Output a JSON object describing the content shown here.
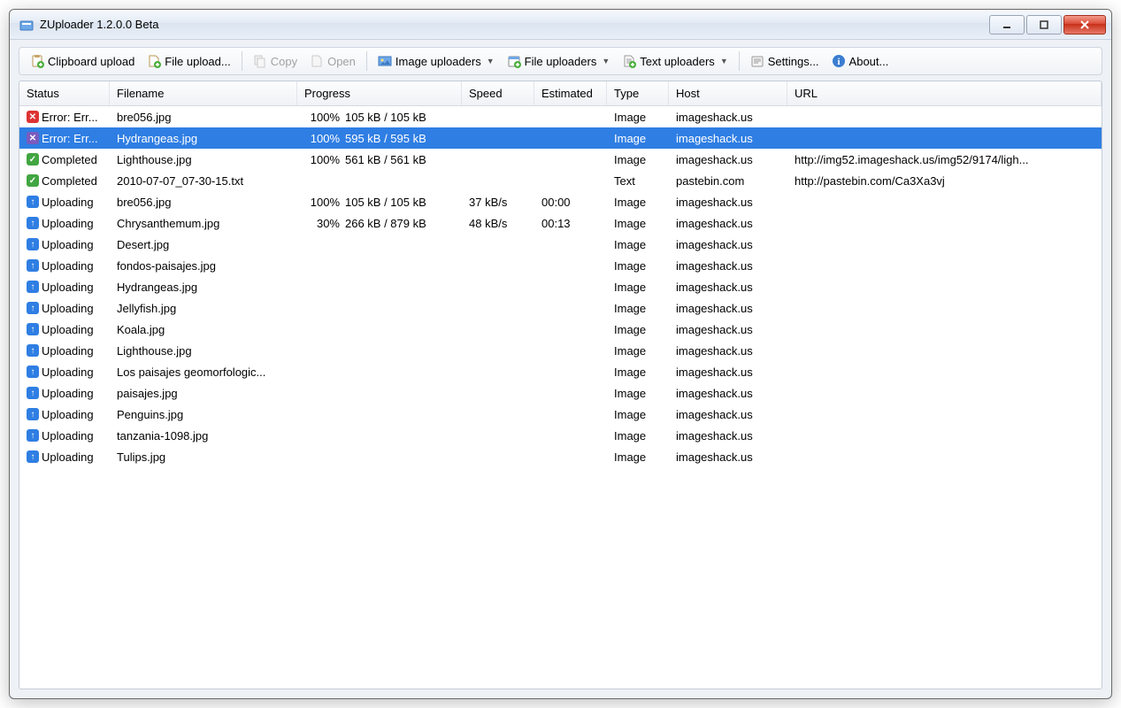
{
  "window": {
    "title": "ZUploader 1.2.0.0 Beta"
  },
  "toolbar": {
    "clipboard_upload": "Clipboard upload",
    "file_upload": "File upload...",
    "copy": "Copy",
    "open": "Open",
    "image_uploaders": "Image uploaders",
    "file_uploaders": "File uploaders",
    "text_uploaders": "Text uploaders",
    "settings": "Settings...",
    "about": "About..."
  },
  "columns": {
    "status": "Status",
    "filename": "Filename",
    "progress": "Progress",
    "speed": "Speed",
    "estimated": "Estimated",
    "type": "Type",
    "host": "Host",
    "url": "URL"
  },
  "rows": [
    {
      "status_icon": "error",
      "status": "Error: Err...",
      "filename": "bre056.jpg",
      "pct": "100%",
      "progress": "105 kB / 105 kB",
      "speed": "",
      "est": "",
      "type": "Image",
      "host": "imageshack.us",
      "url": "",
      "selected": false
    },
    {
      "status_icon": "error-sel",
      "status": "Error: Err...",
      "filename": "Hydrangeas.jpg",
      "pct": "100%",
      "progress": "595 kB / 595 kB",
      "speed": "",
      "est": "",
      "type": "Image",
      "host": "imageshack.us",
      "url": "",
      "selected": true
    },
    {
      "status_icon": "ok",
      "status": "Completed",
      "filename": "Lighthouse.jpg",
      "pct": "100%",
      "progress": "561 kB / 561 kB",
      "speed": "",
      "est": "",
      "type": "Image",
      "host": "imageshack.us",
      "url": "http://img52.imageshack.us/img52/9174/ligh...",
      "selected": false
    },
    {
      "status_icon": "ok",
      "status": "Completed",
      "filename": "2010-07-07_07-30-15.txt",
      "pct": "",
      "progress": "",
      "speed": "",
      "est": "",
      "type": "Text",
      "host": "pastebin.com",
      "url": "http://pastebin.com/Ca3Xa3vj",
      "selected": false
    },
    {
      "status_icon": "up",
      "status": "Uploading",
      "filename": "bre056.jpg",
      "pct": "100%",
      "progress": "105 kB / 105 kB",
      "speed": "37 kB/s",
      "est": "00:00",
      "type": "Image",
      "host": "imageshack.us",
      "url": "",
      "selected": false
    },
    {
      "status_icon": "up",
      "status": "Uploading",
      "filename": "Chrysanthemum.jpg",
      "pct": "30%",
      "progress": "266 kB / 879 kB",
      "speed": "48 kB/s",
      "est": "00:13",
      "type": "Image",
      "host": "imageshack.us",
      "url": "",
      "selected": false
    },
    {
      "status_icon": "up",
      "status": "Uploading",
      "filename": "Desert.jpg",
      "pct": "",
      "progress": "",
      "speed": "",
      "est": "",
      "type": "Image",
      "host": "imageshack.us",
      "url": "",
      "selected": false
    },
    {
      "status_icon": "up",
      "status": "Uploading",
      "filename": "fondos-paisajes.jpg",
      "pct": "",
      "progress": "",
      "speed": "",
      "est": "",
      "type": "Image",
      "host": "imageshack.us",
      "url": "",
      "selected": false
    },
    {
      "status_icon": "up",
      "status": "Uploading",
      "filename": "Hydrangeas.jpg",
      "pct": "",
      "progress": "",
      "speed": "",
      "est": "",
      "type": "Image",
      "host": "imageshack.us",
      "url": "",
      "selected": false
    },
    {
      "status_icon": "up",
      "status": "Uploading",
      "filename": "Jellyfish.jpg",
      "pct": "",
      "progress": "",
      "speed": "",
      "est": "",
      "type": "Image",
      "host": "imageshack.us",
      "url": "",
      "selected": false
    },
    {
      "status_icon": "up",
      "status": "Uploading",
      "filename": "Koala.jpg",
      "pct": "",
      "progress": "",
      "speed": "",
      "est": "",
      "type": "Image",
      "host": "imageshack.us",
      "url": "",
      "selected": false
    },
    {
      "status_icon": "up",
      "status": "Uploading",
      "filename": "Lighthouse.jpg",
      "pct": "",
      "progress": "",
      "speed": "",
      "est": "",
      "type": "Image",
      "host": "imageshack.us",
      "url": "",
      "selected": false
    },
    {
      "status_icon": "up",
      "status": "Uploading",
      "filename": "Los paisajes geomorfologic...",
      "pct": "",
      "progress": "",
      "speed": "",
      "est": "",
      "type": "Image",
      "host": "imageshack.us",
      "url": "",
      "selected": false
    },
    {
      "status_icon": "up",
      "status": "Uploading",
      "filename": "paisajes.jpg",
      "pct": "",
      "progress": "",
      "speed": "",
      "est": "",
      "type": "Image",
      "host": "imageshack.us",
      "url": "",
      "selected": false
    },
    {
      "status_icon": "up",
      "status": "Uploading",
      "filename": "Penguins.jpg",
      "pct": "",
      "progress": "",
      "speed": "",
      "est": "",
      "type": "Image",
      "host": "imageshack.us",
      "url": "",
      "selected": false
    },
    {
      "status_icon": "up",
      "status": "Uploading",
      "filename": "tanzania-1098.jpg",
      "pct": "",
      "progress": "",
      "speed": "",
      "est": "",
      "type": "Image",
      "host": "imageshack.us",
      "url": "",
      "selected": false
    },
    {
      "status_icon": "up",
      "status": "Uploading",
      "filename": "Tulips.jpg",
      "pct": "",
      "progress": "",
      "speed": "",
      "est": "",
      "type": "Image",
      "host": "imageshack.us",
      "url": "",
      "selected": false
    }
  ]
}
